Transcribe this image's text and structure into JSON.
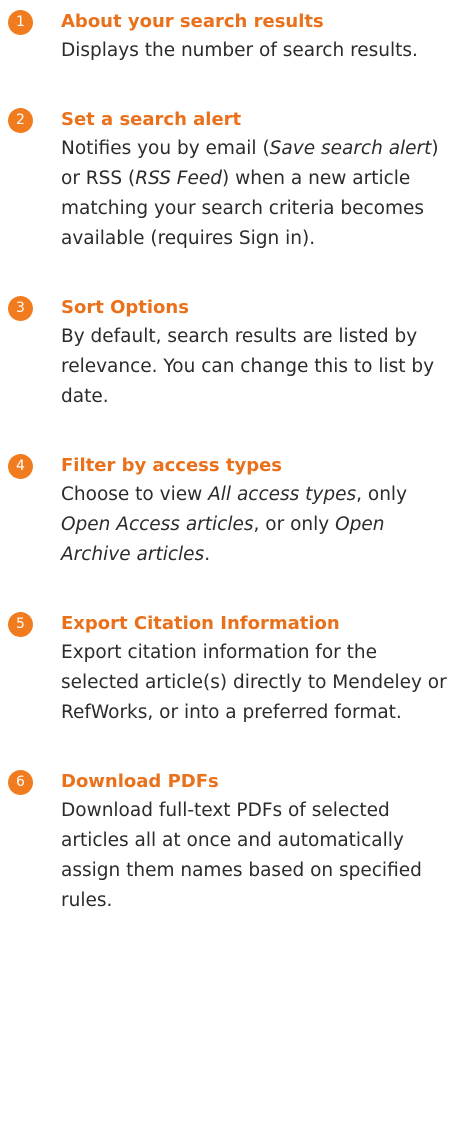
{
  "colors": {
    "accent": "#f07c1f",
    "title": "#e9711c",
    "text": "#2b2b2b",
    "background": "#ffffff"
  },
  "items": [
    {
      "number": "1",
      "title": "About your search results",
      "desc": [
        {
          "t": "Displays the number of search results."
        }
      ]
    },
    {
      "number": "2",
      "title": "Set a search alert",
      "desc": [
        {
          "t": "Notifies you by email ("
        },
        {
          "t": "Save search alert",
          "i": true
        },
        {
          "t": ") or RSS ("
        },
        {
          "t": "RSS Feed",
          "i": true
        },
        {
          "t": ") when a new article matching your search criteria becomes available (requires Sign in)."
        }
      ]
    },
    {
      "number": "3",
      "title": "Sort Options",
      "desc": [
        {
          "t": "By default, search results are listed by relevance. You can change this to list by date."
        }
      ]
    },
    {
      "number": "4",
      "title": "Filter by access types",
      "desc": [
        {
          "t": "Choose to view "
        },
        {
          "t": "All access types",
          "i": true
        },
        {
          "t": ", only "
        },
        {
          "t": "Open Access articles",
          "i": true
        },
        {
          "t": ", or only "
        },
        {
          "t": "Open Archive articles",
          "i": true
        },
        {
          "t": "."
        }
      ]
    },
    {
      "number": "5",
      "title": "Export Citation Information",
      "desc": [
        {
          "t": "Export citation information for the selected article(s) directly to Mendeley or RefWorks, or into a preferred format."
        }
      ]
    },
    {
      "number": "6",
      "title": "Download PDFs",
      "desc": [
        {
          "t": "Download full-text PDFs of selected articles all at once and automatically assign them names based on specified rules."
        }
      ]
    }
  ]
}
